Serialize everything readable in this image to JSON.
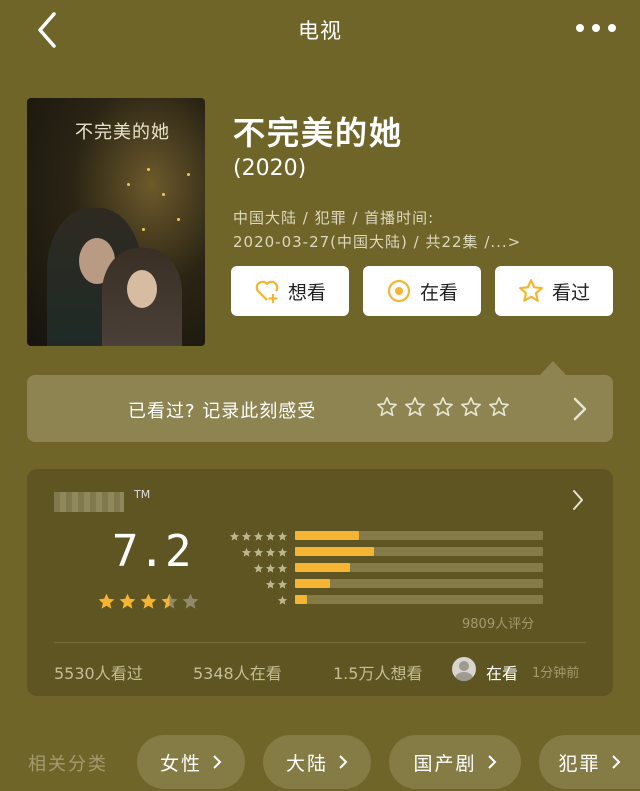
{
  "header": {
    "title": "电视",
    "back_icon": "chevron-left-icon",
    "more_icon": "more-dots-icon"
  },
  "movie": {
    "title": "不完美的她",
    "year": "(2020)",
    "meta_line1": "中国大陆 / 犯罪 / 首播时间:",
    "meta_line2": "2020-03-27(中国大陆) / 共22集 /...>",
    "poster_title": "不完美的她"
  },
  "actions": [
    {
      "label": "想看",
      "icon": "heart-plus-icon"
    },
    {
      "label": "在看",
      "icon": "circle-dot-icon"
    },
    {
      "label": "看过",
      "icon": "star-outline-icon"
    }
  ],
  "record": {
    "label": "已看过? 记录此刻感受",
    "stars": 5
  },
  "rating": {
    "tm": "TM",
    "score": "7.2",
    "stars_filled": 3.5,
    "distribution": [
      0.26,
      0.32,
      0.22,
      0.14,
      0.05
    ],
    "raters": "9809人评分",
    "colors": {
      "fill": "#f5b432",
      "empty": "#8f8a6a"
    }
  },
  "stats": {
    "watched": "5530人看过",
    "watching": "5348人在看",
    "want": "1.5万人想看",
    "friend_status": "在看",
    "time_ago": "1分钟前"
  },
  "categories": {
    "label": "相关分类",
    "items": [
      "女性",
      "大陆",
      "国产剧",
      "犯罪"
    ]
  }
}
